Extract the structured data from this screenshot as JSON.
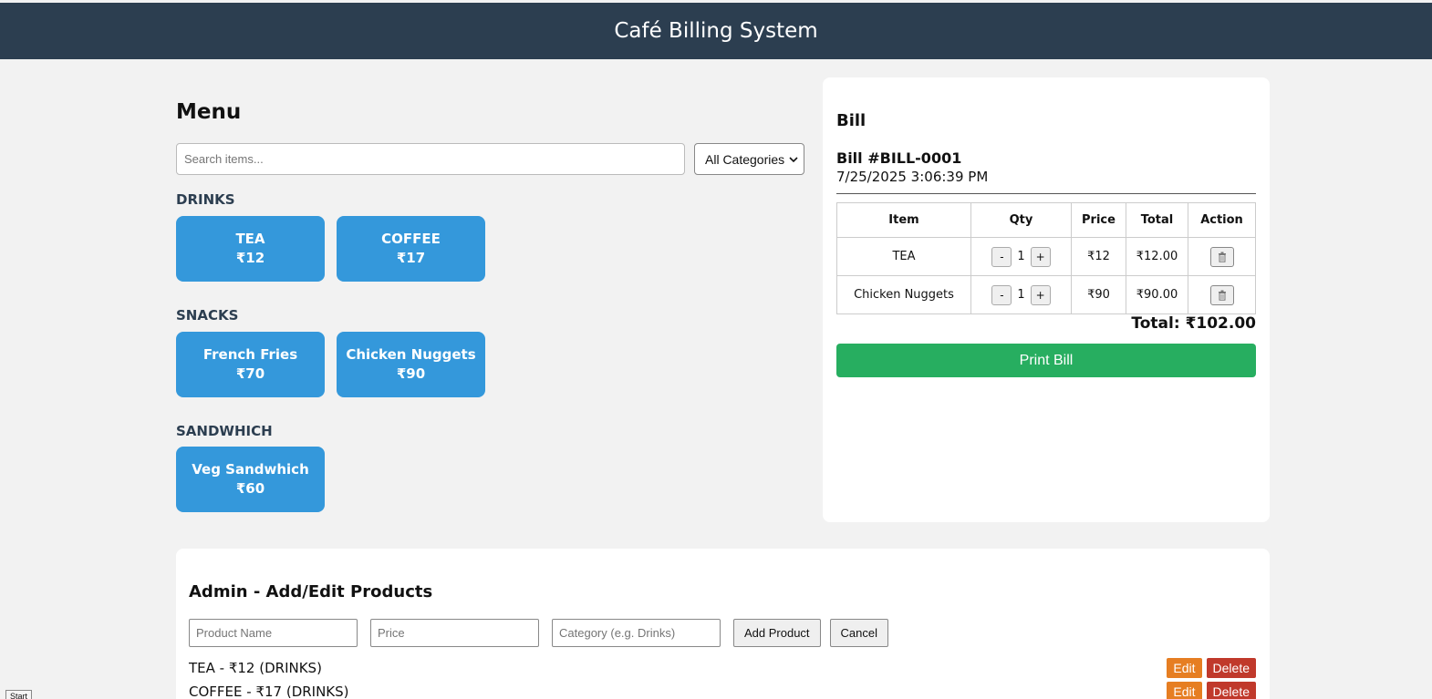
{
  "header": {
    "title": "Café Billing System"
  },
  "menu": {
    "title": "Menu",
    "search_placeholder": "Search items...",
    "category_selected": "All Categories",
    "categories": [
      {
        "name": "DRINKS",
        "items": [
          {
            "name": "TEA",
            "price": "₹12"
          },
          {
            "name": "COFFEE",
            "price": "₹17"
          }
        ]
      },
      {
        "name": "SNACKS",
        "items": [
          {
            "name": "French Fries",
            "price": "₹70"
          },
          {
            "name": "Chicken Nuggets",
            "price": "₹90"
          }
        ]
      },
      {
        "name": "SANDWHICH",
        "items": [
          {
            "name": "Veg Sandwhich",
            "price": "₹60"
          }
        ]
      }
    ]
  },
  "bill": {
    "title": "Bill",
    "bill_number": "Bill #BILL-0001",
    "datetime": "7/25/2025 3:06:39 PM",
    "columns": [
      "Item",
      "Qty",
      "Price",
      "Total",
      "Action"
    ],
    "rows": [
      {
        "item": "TEA",
        "qty": "1",
        "price": "₹12",
        "total": "₹12.00",
        "minus": "-",
        "plus": "+"
      },
      {
        "item": "Chicken Nuggets",
        "qty": "1",
        "price": "₹90",
        "total": "₹90.00",
        "minus": "-",
        "plus": "+"
      }
    ],
    "total": "Total: ₹102.00",
    "print_label": "Print Bill"
  },
  "admin": {
    "title": "Admin - Add/Edit Products",
    "name_placeholder": "Product Name",
    "price_placeholder": "Price",
    "category_placeholder": "Category (e.g. Drinks)",
    "add_label": "Add Product",
    "cancel_label": "Cancel",
    "products": [
      {
        "text": "TEA - ₹12 (DRINKS)",
        "edit": "Edit",
        "delete": "Delete"
      },
      {
        "text": "COFFEE - ₹17 (DRINKS)",
        "edit": "Edit",
        "delete": "Delete"
      }
    ]
  },
  "taskbar": {
    "start_label": "Start"
  },
  "colors": {
    "header": "#2c3e50",
    "item_button": "#3498db",
    "print_button": "#27ae60",
    "edit": "#e67e22",
    "delete": "#c0392b"
  }
}
